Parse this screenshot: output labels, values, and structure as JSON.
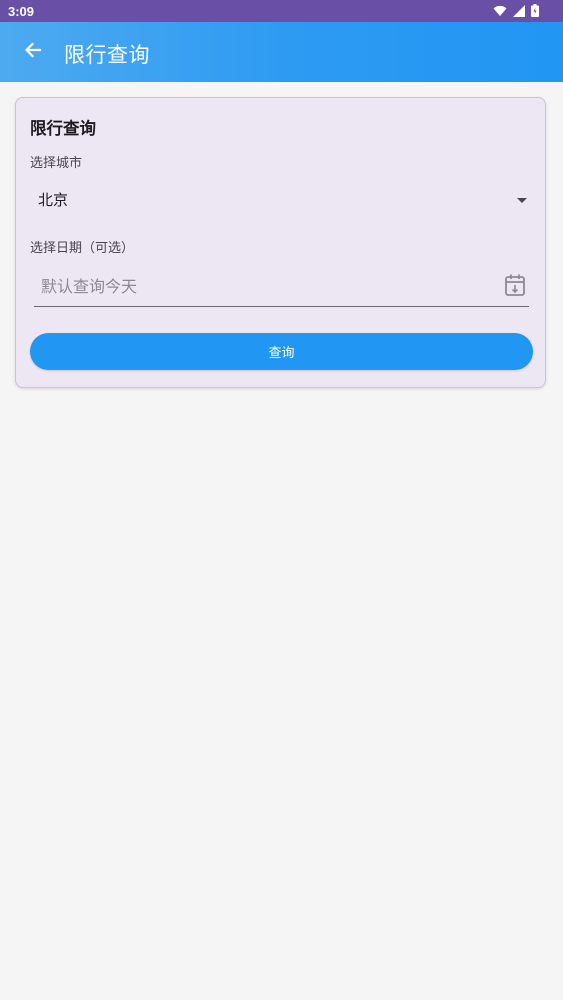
{
  "status_bar": {
    "time": "3:09",
    "icons": [
      "wifi-icon",
      "signal-icon",
      "battery-icon"
    ]
  },
  "app_bar": {
    "title": "限行查询",
    "back_icon": "arrow-left-icon",
    "gradient_colors": [
      "#4daaf0",
      "#2196f3"
    ]
  },
  "card": {
    "title": "限行查询",
    "city_label": "选择城市",
    "city_value": "北京",
    "city_dropdown_icon": "caret-down-icon",
    "date_label": "选择日期（可选）",
    "date_value": "",
    "date_placeholder": "默认查询今天",
    "date_icon": "calendar-icon",
    "query_button": "查询"
  },
  "colors": {
    "status_bar": "#6a4fa6",
    "primary": "#2196f3",
    "card_background": "#ede7f4",
    "page_background": "#f5f5f5"
  }
}
